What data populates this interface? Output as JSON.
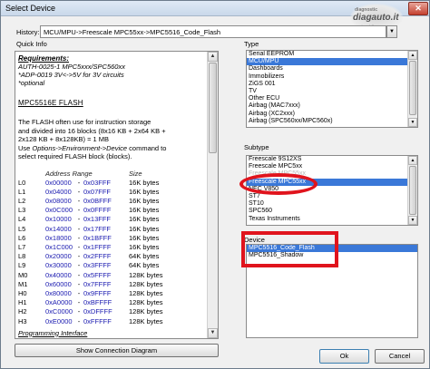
{
  "window": {
    "title": "Select Device",
    "close_glyph": "✕"
  },
  "logo": {
    "line1": "diagnostic",
    "line2": "diagauto.it",
    "line3": "automobilismo"
  },
  "history": {
    "label": "History:",
    "value": "MCU/MPU->Freescale MPC55xx->MPC5516_Code_Flash"
  },
  "quick_info": {
    "label": "Quick Info",
    "requirements_title": "Requirements:",
    "requirement_lines": [
      "AUTH-0025-1 MPC5xxx/SPC560xx",
      "*ADP-0019 3V<->5V for 3V circuits",
      "*optional"
    ],
    "section_title": "MPC5516E FLASH",
    "para_lines": [
      "The FLASH often use for instruction storage",
      "and divided into 16 blocks (8x16 KB + 2x64 KB +",
      "2x128 KB + 8x128KB) = 1 MB"
    ],
    "para_line4_pre": "Use ",
    "para_line4_opt": "Options->Environment->Device",
    "para_line4_post": " command to",
    "para_line5": "select required FLASH block (blocks).",
    "table_headers": {
      "range": "Address Range",
      "size": "Size"
    },
    "blocks": [
      {
        "name": "L0",
        "start": "0x00000",
        "end": "0x03FFF",
        "size": "16K bytes"
      },
      {
        "name": "L1",
        "start": "0x04000",
        "end": "0x07FFF",
        "size": "16K bytes"
      },
      {
        "name": "L2",
        "start": "0x08000",
        "end": "0x0BFFF",
        "size": "16K bytes"
      },
      {
        "name": "L3",
        "start": "0x0C000",
        "end": "0x0FFFF",
        "size": "16K bytes"
      },
      {
        "name": "L4",
        "start": "0x10000",
        "end": "0x13FFF",
        "size": "16K bytes"
      },
      {
        "name": "L5",
        "start": "0x14000",
        "end": "0x17FFF",
        "size": "16K bytes"
      },
      {
        "name": "L6",
        "start": "0x18000",
        "end": "0x1BFFF",
        "size": "16K bytes"
      },
      {
        "name": "L7",
        "start": "0x1C000",
        "end": "0x1FFFF",
        "size": "16K bytes"
      },
      {
        "name": "L8",
        "start": "0x20000",
        "end": "0x2FFFF",
        "size": "64K bytes"
      },
      {
        "name": "L9",
        "start": "0x30000",
        "end": "0x3FFFF",
        "size": "64K bytes"
      },
      {
        "name": "M0",
        "start": "0x40000",
        "end": "0x5FFFF",
        "size": "128K bytes"
      },
      {
        "name": "M1",
        "start": "0x60000",
        "end": "0x7FFFF",
        "size": "128K bytes"
      },
      {
        "name": "H0",
        "start": "0x80000",
        "end": "0x9FFFF",
        "size": "128K bytes"
      },
      {
        "name": "H1",
        "start": "0xA0000",
        "end": "0xBFFFF",
        "size": "128K bytes"
      },
      {
        "name": "H2",
        "start": "0xC0000",
        "end": "0xDFFFF",
        "size": "128K bytes"
      },
      {
        "name": "H3",
        "start": "0xE0000",
        "end": "0xFFFFF",
        "size": "128K bytes"
      }
    ],
    "programming_title": "Programming Interface",
    "scroll_up": "▲",
    "scroll_down": "▼"
  },
  "show_diagram_button": "Show Connection Diagram",
  "type_group": {
    "label": "Type",
    "items": [
      "Serial EEPROM",
      "MCU/MPU",
      "Dashboards",
      "Immobilizers",
      "ZiGS 001",
      "TV",
      "Other ECU",
      "Airbag (MAC7xxx)",
      "Airbag (XC2xxx)",
      "Airbag (SPC560xx/MPC560x)"
    ],
    "selected_index": 1
  },
  "subtype_group": {
    "label": "Subtype",
    "items": [
      "Freescale 9S12XS",
      "Freescale MPC5xx",
      "Freescale MPC55xx",
      "Freescale MPC55xx",
      "NEC V850",
      "ST7",
      "ST10",
      "SPC560",
      "Texas Instruments"
    ],
    "dim_indices": [
      2
    ],
    "selected_index": 3
  },
  "device_group": {
    "label": "Device",
    "items": [
      "MPC5516_Code_Flash",
      "MPC5516_Shadow"
    ],
    "selected_index": 0
  },
  "ok_button": "Ok",
  "cancel_button": "Cancel",
  "colors": {
    "selection": "#3a78d8",
    "highlight": "#e0141d",
    "address": "#1a1ab0"
  }
}
